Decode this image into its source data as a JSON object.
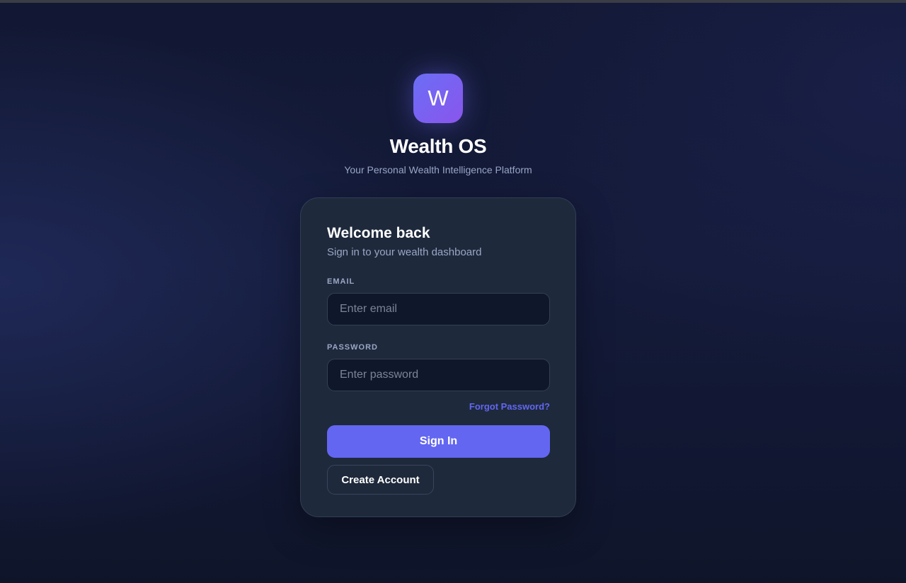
{
  "brand": {
    "logo_letter": "W",
    "title": "Wealth OS",
    "subtitle": "Your Personal Wealth Intelligence Platform"
  },
  "login_card": {
    "heading": "Welcome back",
    "subheading": "Sign in to your wealth dashboard",
    "email": {
      "label": "EMAIL",
      "value": "",
      "placeholder": "Enter email"
    },
    "password": {
      "label": "PASSWORD",
      "value": "",
      "placeholder": "Enter password"
    },
    "forgot_password_link": "Forgot Password?",
    "sign_in_button": "Sign In",
    "create_account_button": "Create Account"
  },
  "colors": {
    "accent": "#6366f1",
    "logo_gradient_start": "#6a6ef6",
    "logo_gradient_end": "#8a55ec",
    "card_background": "#1e293b",
    "input_background": "#0f172a",
    "page_background": "#141b3a",
    "muted_text": "#9aa6c6"
  }
}
